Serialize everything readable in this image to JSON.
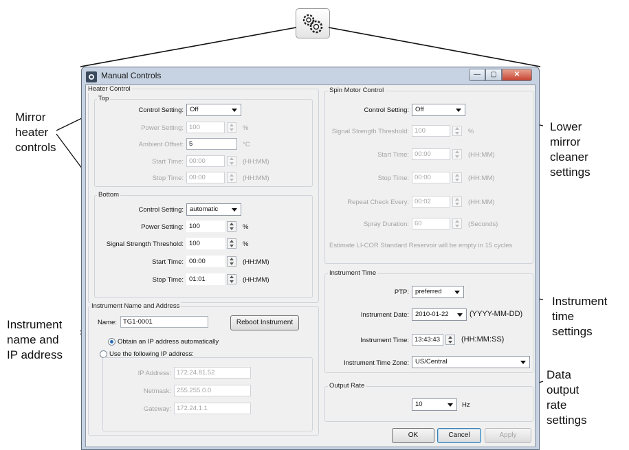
{
  "window": {
    "title": "Manual Controls"
  },
  "heater": {
    "group_label": "Heater Control",
    "top": {
      "label": "Top",
      "control_setting_label": "Control Setting:",
      "control_setting_value": "Off",
      "power_setting_label": "Power Setting:",
      "power_setting_value": "100",
      "power_unit": "%",
      "ambient_offset_label": "Ambient Offset:",
      "ambient_offset_value": "5",
      "ambient_unit": "°C",
      "start_time_label": "Start Time:",
      "start_time_value": "00:00",
      "stop_time_label": "Stop Time:",
      "stop_time_value": "00:00",
      "time_unit": "(HH:MM)"
    },
    "bottom": {
      "label": "Bottom",
      "control_setting_label": "Control Setting:",
      "control_setting_value": "automatic",
      "power_setting_label": "Power Setting:",
      "power_setting_value": "100",
      "power_unit": "%",
      "signal_label": "Signal Strength Threshold:",
      "signal_value": "100",
      "signal_unit": "%",
      "start_time_label": "Start Time:",
      "start_time_value": "00:00",
      "stop_time_label": "Stop Time:",
      "stop_time_value": "01:01",
      "time_unit": "(HH:MM)"
    }
  },
  "instrument": {
    "group_label": "Instrument Name and Address",
    "name_label": "Name:",
    "name_value": "TG1-0001",
    "reboot_button": "Reboot Instrument",
    "radio_auto": "Obtain an IP address automatically",
    "radio_manual": "Use the following IP address:",
    "ip_label": "IP Address:",
    "ip_value": "172.24.81.52",
    "netmask_label": "Netmask:",
    "netmask_value": "255.255.0.0",
    "gateway_label": "Gateway:",
    "gateway_value": "172.24.1.1"
  },
  "spin": {
    "group_label": "Spin Motor Control",
    "control_setting_label": "Control Setting:",
    "control_setting_value": "Off",
    "signal_label": "Signal Strength Threshold:",
    "signal_value": "100",
    "signal_unit": "%",
    "start_time_label": "Start Time:",
    "start_time_value": "00:00",
    "stop_time_label": "Stop Time:",
    "stop_time_value": "00:00",
    "repeat_label": "Repeat Check Every:",
    "repeat_value": "00:02",
    "time_unit": "(HH:MM)",
    "spray_label": "Spray Duration:",
    "spray_value": "60",
    "spray_unit": "(Seconds)",
    "estimate_text": "Estimate LI-COR Standard Reservoir will be empty in 15 cycles"
  },
  "time": {
    "group_label": "Instrument Time",
    "ptp_label": "PTP:",
    "ptp_value": "preferred",
    "date_label": "Instrument Date:",
    "date_value": "2010-01-22",
    "date_unit": "(YYYY-MM-DD)",
    "time_label": "Instrument Time:",
    "time_value": "13:43:43",
    "time_unit": "(HH:MM:SS)",
    "zone_label": "Instrument Time Zone:",
    "zone_value": "US/Central"
  },
  "output": {
    "group_label": "Output Rate",
    "rate_value": "10",
    "rate_unit": "Hz"
  },
  "buttons": {
    "ok": "OK",
    "cancel": "Cancel",
    "apply": "Apply"
  },
  "callouts": {
    "mirror_heater": [
      "Mirror",
      "heater",
      "controls"
    ],
    "instrument_name": [
      "Instrument",
      "name and",
      "IP address"
    ],
    "lower_mirror": [
      "Lower",
      "mirror",
      "cleaner",
      "settings"
    ],
    "instrument_time": [
      "Instrument",
      "time",
      "settings"
    ],
    "data_output": [
      "Data",
      "output",
      "rate",
      "settings"
    ]
  },
  "icons": {
    "top": "gears-icon",
    "app": "app-icon"
  }
}
